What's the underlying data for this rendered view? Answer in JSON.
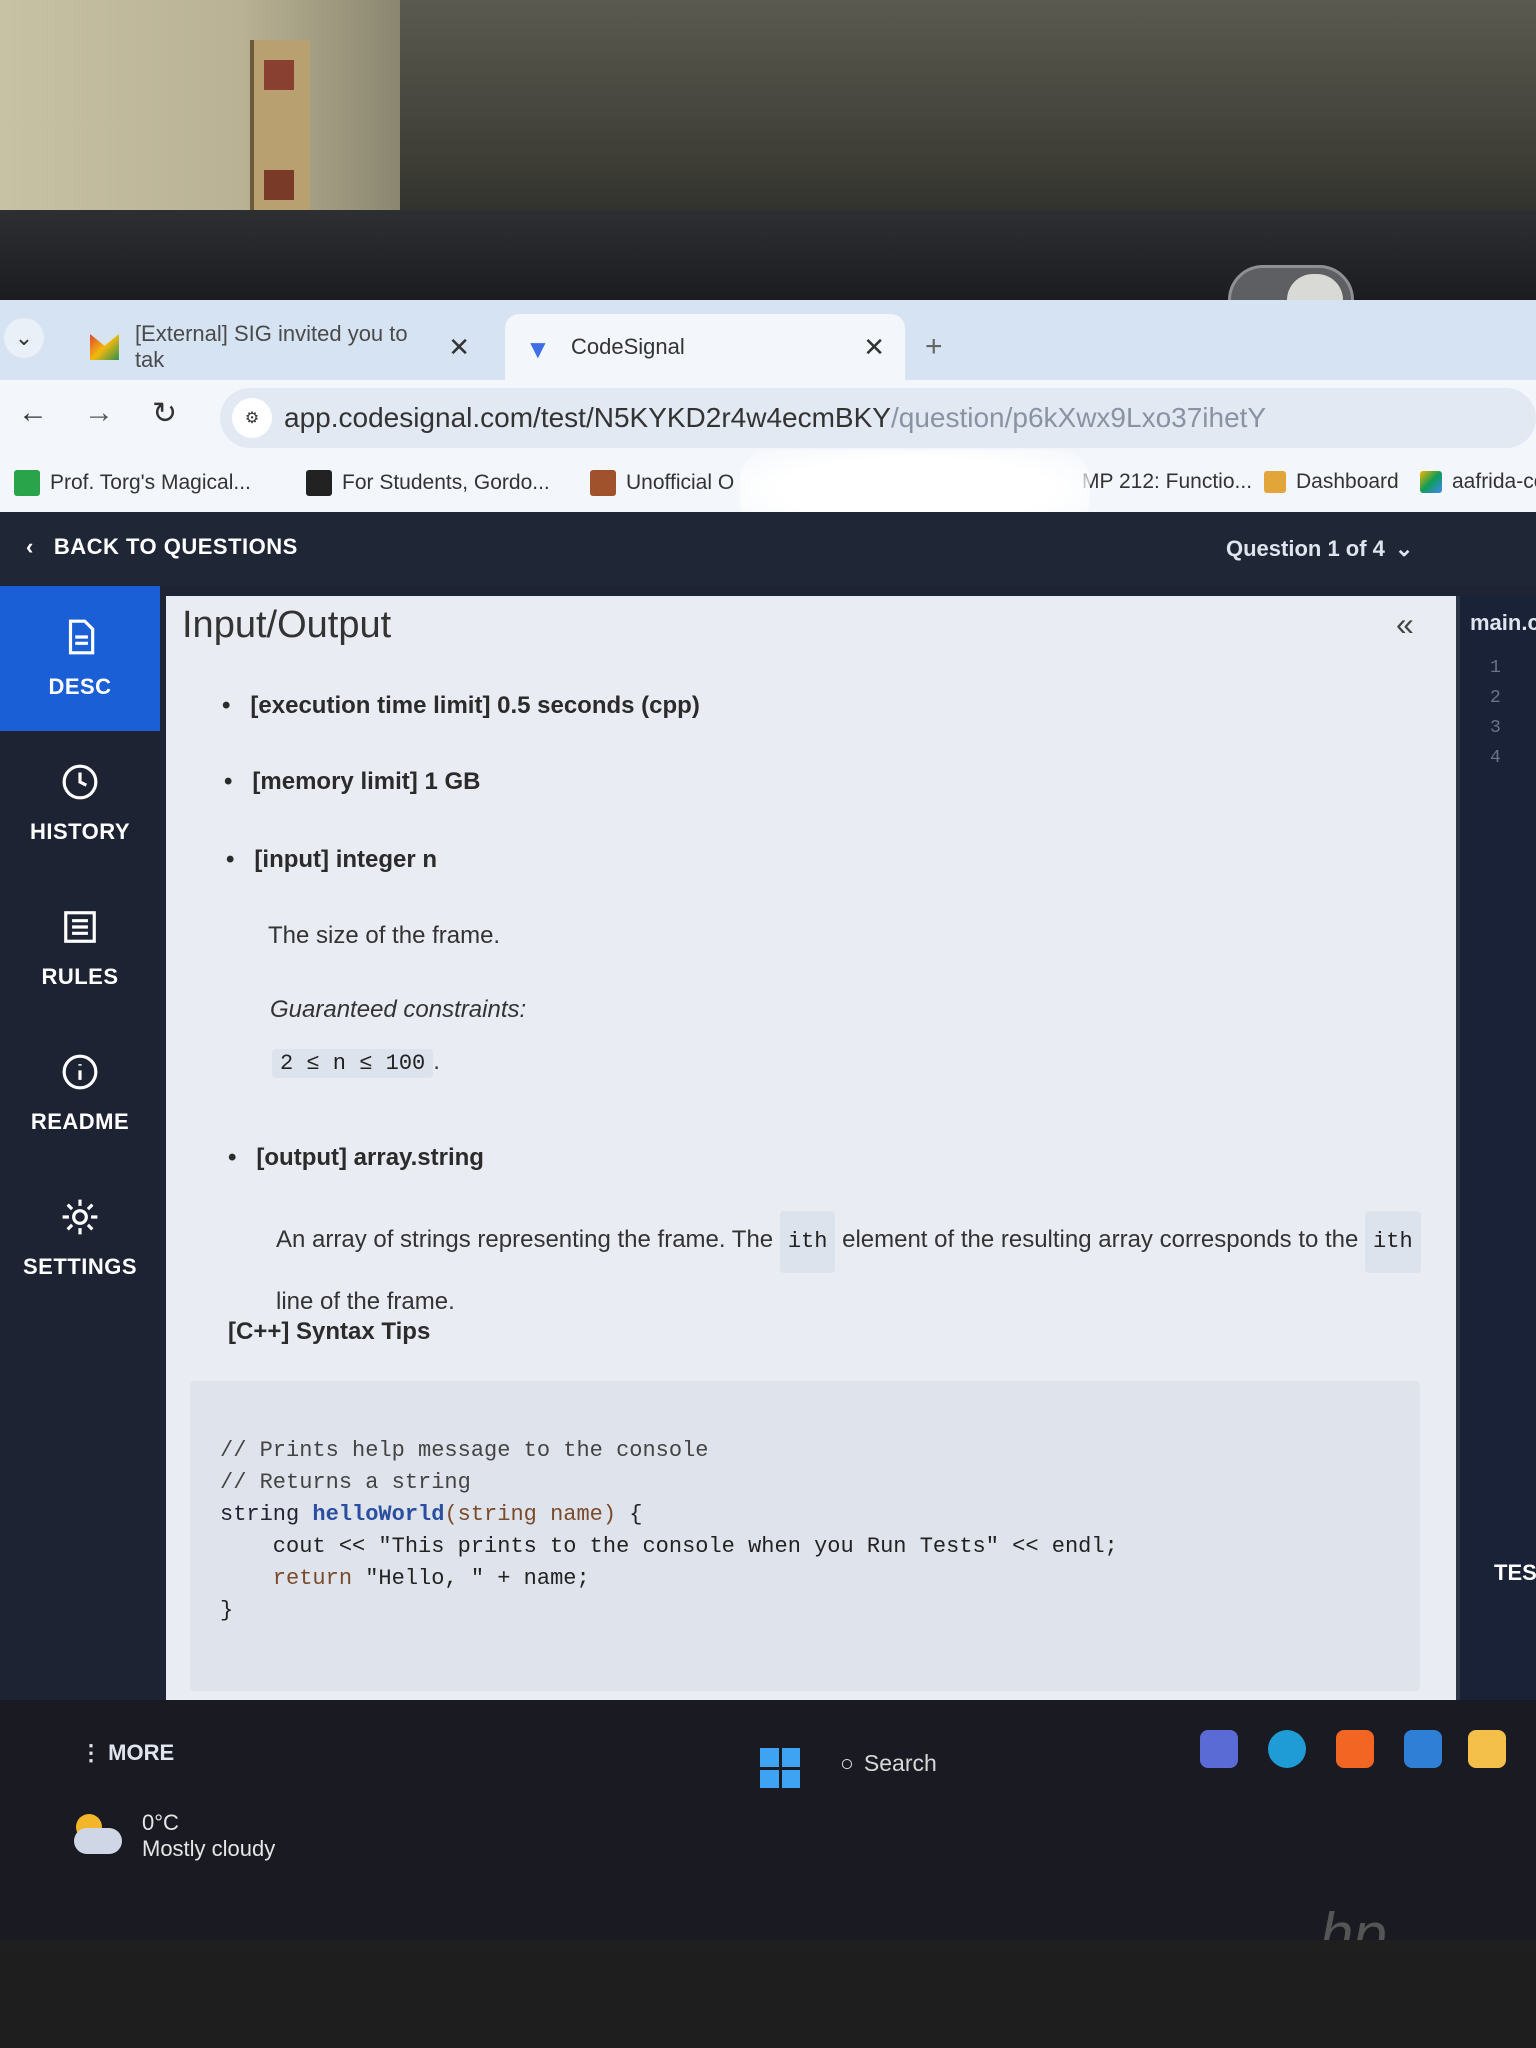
{
  "browser": {
    "tabs": [
      {
        "label": "[External] SIG invited you to tak",
        "active": false
      },
      {
        "label": "CodeSignal",
        "active": true
      }
    ],
    "url": {
      "main": "app.codesignal.com/test/N5KYKD2r4w4ecmBKY",
      "dim": "/question/p6kXwx9Lxo37ihetY"
    },
    "bookmarks": [
      {
        "label": "Prof. Torg's Magical..."
      },
      {
        "label": "For Students, Gordo..."
      },
      {
        "label": "Unofficial O"
      },
      {
        "label": "MP 212: Functio..."
      },
      {
        "label": "Dashboard"
      },
      {
        "label": "aafrida-cor"
      }
    ]
  },
  "header": {
    "back_label": "BACK TO QUESTIONS",
    "question_selector": "Question 1 of 4"
  },
  "sidebar": {
    "items": [
      {
        "label": "DESC",
        "icon": "document-icon",
        "active": true
      },
      {
        "label": "HISTORY",
        "icon": "clock-icon"
      },
      {
        "label": "RULES",
        "icon": "list-icon"
      },
      {
        "label": "README",
        "icon": "info-icon"
      },
      {
        "label": "SETTINGS",
        "icon": "gear-icon"
      }
    ],
    "more_label": "MORE"
  },
  "content": {
    "title": "Input/Output",
    "bullets": {
      "time": "[execution time limit] 0.5 seconds (cpp)",
      "memory": "[memory limit] 1 GB",
      "input": "[input] integer n",
      "output": "[output] array.string"
    },
    "input_desc": "The size of the frame.",
    "constraints_label": "Guaranteed constraints:",
    "constraint": "2 ≤ n ≤ 100",
    "constraint_suffix": ".",
    "output_desc_part1": "An array of strings representing the frame. The",
    "output_desc_code": "ith",
    "output_desc_part2": "element of the resulting array corresponds to the",
    "output_desc_code2": "ith",
    "output_desc_part3": "line of the frame.",
    "syntax_title": "[C++] Syntax Tips",
    "code": {
      "line1": "// Prints help message to the console",
      "line2": "// Returns a string",
      "line3_a": "string ",
      "line3_fn": "helloWorld",
      "line3_params": "(string name)",
      "line3_b": " {",
      "line4": "    cout << \"This prints to the console when you Run Tests\" << endl;",
      "line5_kw": "    return",
      "line5_rest": " \"Hello, \" + name;",
      "line6": "}"
    }
  },
  "editor": {
    "filename": "main.c",
    "line_numbers": [
      "1",
      "2",
      "3",
      "4"
    ],
    "tests_label": "TES"
  },
  "taskbar": {
    "temperature": "0°C",
    "weather": "Mostly cloudy",
    "search_label": "Search"
  },
  "colors": {
    "accent": "#1b5fd6",
    "app_header": "#1f2636",
    "sidebar": "#1d2333",
    "content_bg": "#e9edf3"
  }
}
